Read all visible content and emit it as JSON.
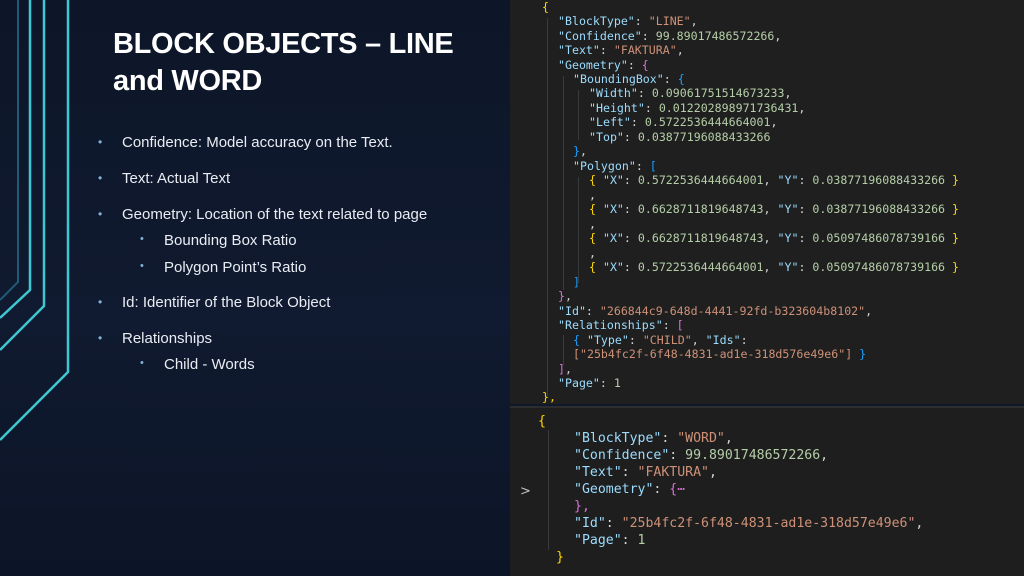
{
  "slide": {
    "title_line1": "BLOCK OBJECTS – LINE",
    "title_line2": "and WORD",
    "bullets": [
      "Confidence: Model accuracy on the Text.",
      "Text: Actual Text",
      "Geometry: Location of the text related to page",
      "Bounding Box Ratio",
      "Polygon Point’s Ratio",
      "Id: Identifier of the Block Object",
      "Relationships",
      "Child - Words"
    ],
    "bullet_glyph": "•"
  },
  "code_line": {
    "open_brace": "{",
    "block_type_key": "\"BlockType\"",
    "block_type_val": "\"LINE\"",
    "confidence_key": "\"Confidence\"",
    "confidence_val": "99.89017486572266",
    "text_key": "\"Text\"",
    "text_val": "\"FAKTURA\"",
    "geometry_key": "\"Geometry\"",
    "bbox_key": "\"BoundingBox\"",
    "width_key": "\"Width\"",
    "width_val": "0.09061751514673233",
    "height_key": "\"Height\"",
    "height_val": "0.012202898971736431",
    "left_key": "\"Left\"",
    "left_val": "0.5722536444664001",
    "top_key": "\"Top\"",
    "top_val": "0.03877196088433266",
    "polygon_key": "\"Polygon\"",
    "points": [
      {
        "x": "0.5722536444664001",
        "y": "0.03877196088433266"
      },
      {
        "x": "0.6628711819648743",
        "y": "0.03877196088433266"
      },
      {
        "x": "0.6628711819648743",
        "y": "0.05097486078739166"
      },
      {
        "x": "0.5722536444664001",
        "y": "0.05097486078739166"
      }
    ],
    "x_key": "\"X\"",
    "y_key": "\"Y\"",
    "id_key": "\"Id\"",
    "id_val": "\"266844c9-648d-4441-92fd-b323604b8102\"",
    "relationships_key": "\"Relationships\"",
    "type_key": "\"Type\"",
    "type_val": "\"CHILD\"",
    "ids_key": "\"Ids\"",
    "ids_val": "[\"25b4fc2f-6f48-4831-ad1e-318d576e49e6\"]",
    "page_key": "\"Page\"",
    "page_val": "1",
    "close_brace": "},"
  },
  "code_word": {
    "open_brace": "{",
    "block_type_key": "\"BlockType\"",
    "block_type_val": "\"WORD\"",
    "confidence_key": "\"Confidence\"",
    "confidence_val": "99.89017486572266",
    "text_key": "\"Text\"",
    "text_val": "\"FAKTURA\"",
    "geometry_key": "\"Geometry\"",
    "geometry_collapsed": "{⋯",
    "geometry_close": "},",
    "id_key": "\"Id\"",
    "id_val": "\"25b4fc2f-6f48-4831-ad1e-318d57e49e6\"",
    "page_key": "\"Page\"",
    "page_val": "1",
    "close_brace": "}",
    "fold_arrow": ">"
  }
}
